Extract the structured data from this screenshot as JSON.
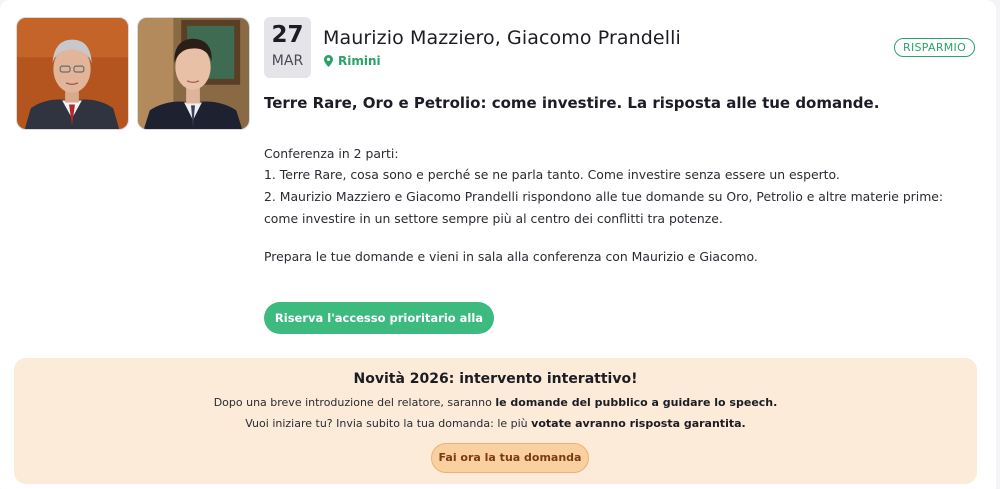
{
  "event": {
    "day": "27",
    "month": "MAR",
    "speakers": "Maurizio Mazziero, Giacomo Prandelli",
    "location": "Rimini",
    "badge": "RISPARMIO",
    "headline": "Terre Rare, Oro e Petrolio: come investire. La risposta alle tue domande.",
    "description": [
      "Conferenza in 2 parti:",
      "1. Terre Rare, cosa sono e perché se ne parla tanto. Come investire senza essere un esperto.",
      "2. Maurizio Mazziero e Giacomo Prandelli rispondono alle tue domande su Oro, Petrolio e altre materie prime:",
      "come investire in un settore sempre più al centro dei conflitti tra potenze.",
      "Prepara le tue domande e vieni in sala alla conferenza con Maurizio e Giacomo."
    ],
    "cta_label": "Riserva l'accesso prioritario alla sala"
  },
  "promo": {
    "title": "Novità 2026: intervento interattivo!",
    "line1_prefix": "Dopo una breve introduzione del relatore, saranno ",
    "line1_bold": "le domande del pubblico a guidare lo speech.",
    "line2_prefix": "Vuoi iniziare tu? Invia subito la tua domanda: le più ",
    "line2_bold": "votate avranno risposta garantita.",
    "button_label": "Fai ora la tua domanda"
  },
  "colors": {
    "accent_green": "#3dbb7e",
    "promo_background": "#fbebd8",
    "promo_button": "#fbd0a0"
  },
  "icons": {
    "location": "map-pin-icon"
  }
}
